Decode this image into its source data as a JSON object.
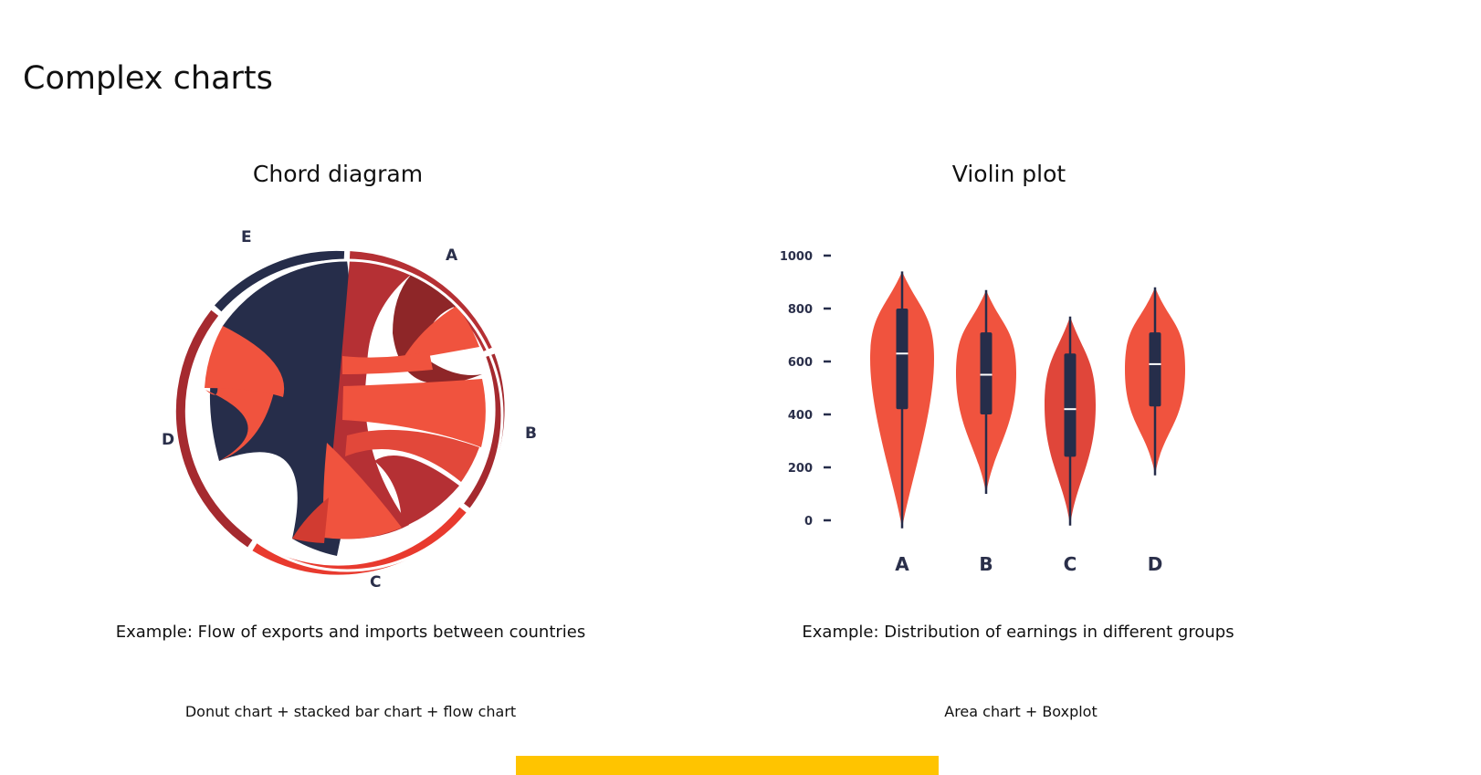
{
  "page": {
    "title": "Complex charts"
  },
  "colors": {
    "accent_bar": "#ffc400",
    "navy": "#262d4a",
    "red": "#f0533e",
    "dark_red": "#a52a2f",
    "mid_red": "#b53034",
    "bright_red": "#e83a2e"
  },
  "chord": {
    "heading": "Chord diagram",
    "caption": "Example: Flow of exports and imports between countries",
    "subcaption": "Donut chart + stacked bar chart + flow chart",
    "labels": {
      "A": "A",
      "B": "B",
      "C": "C",
      "D": "D",
      "E": "E"
    }
  },
  "violin": {
    "heading": "Violin plot",
    "caption": "Example: Distribution of earnings in different groups",
    "subcaption": "Area chart + Boxplot"
  },
  "chart_data": {
    "type": "violin",
    "categories": [
      "A",
      "B",
      "C",
      "D"
    ],
    "y_ticks": [
      0,
      200,
      400,
      600,
      800,
      1000
    ],
    "ylim": [
      0,
      1000
    ],
    "series": [
      {
        "category": "A",
        "min": -30,
        "q1": 420,
        "median": 630,
        "q3": 800,
        "max": 940
      },
      {
        "category": "B",
        "min": 100,
        "q1": 400,
        "median": 550,
        "q3": 710,
        "max": 870
      },
      {
        "category": "C",
        "min": -20,
        "q1": 240,
        "median": 420,
        "q3": 630,
        "max": 770
      },
      {
        "category": "D",
        "min": 170,
        "q1": 430,
        "median": 590,
        "q3": 710,
        "max": 880
      }
    ]
  }
}
